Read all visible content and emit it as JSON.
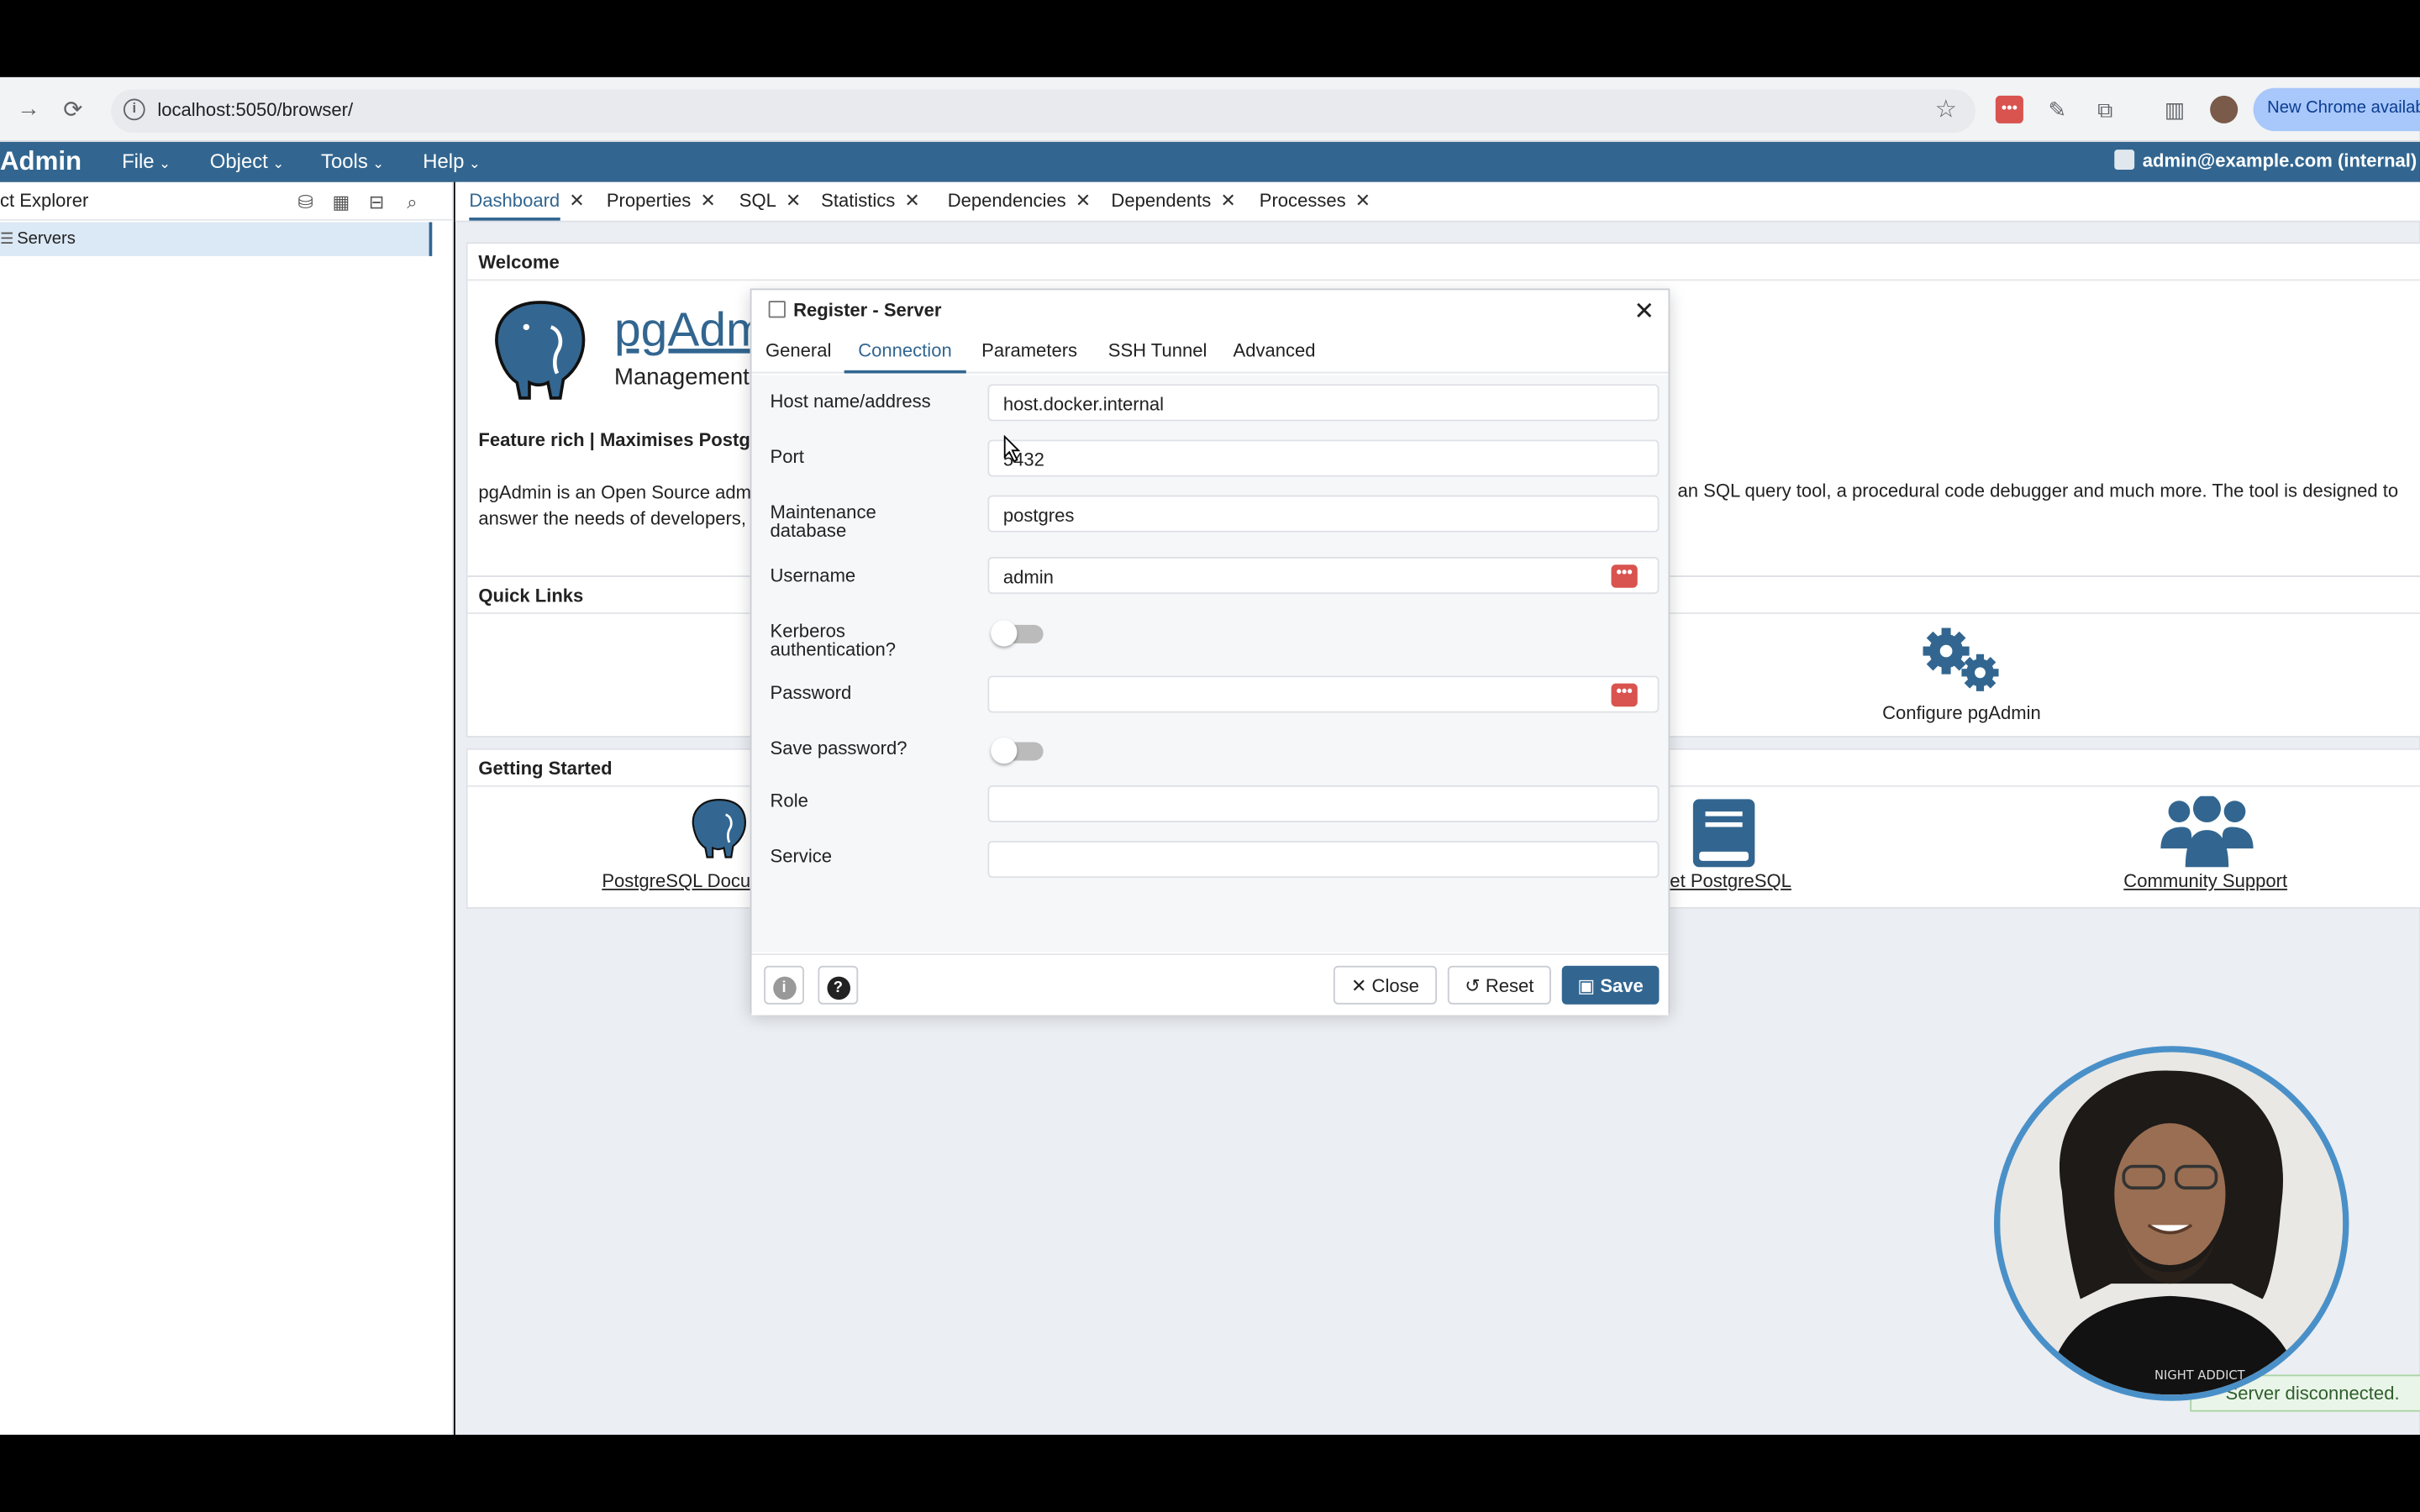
{
  "browser": {
    "url": "localhost:5050/browser/",
    "new_chrome_label": "New Chrome available"
  },
  "header": {
    "logo": "Admin",
    "menus": [
      "File",
      "Object",
      "Tools",
      "Help"
    ],
    "user": "admin@example.com (internal)"
  },
  "explorer": {
    "title": "ct Explorer",
    "items": [
      {
        "label": "Servers"
      }
    ]
  },
  "tabs": [
    {
      "label": "Dashboard"
    },
    {
      "label": "Properties"
    },
    {
      "label": "SQL"
    },
    {
      "label": "Statistics"
    },
    {
      "label": "Dependencies"
    },
    {
      "label": "Dependents"
    },
    {
      "label": "Processes"
    }
  ],
  "welcome": {
    "header": "Welcome",
    "product": "pgAdm",
    "subtitle": "Management",
    "feature": "Feature rich | Maximises Postgre",
    "desc_left": "pgAdmin is an Open Source adm answer the needs of developers,",
    "desc_right": "an SQL query tool, a procedural code debugger and much more. The tool is designed to"
  },
  "quick_links": {
    "header": "Quick Links",
    "configure": "Configure pgAdmin"
  },
  "getting_started": {
    "header": "Getting Started",
    "docs": "PostgreSQL Docu",
    "get": "et PostgreSQL",
    "community": "Community Support"
  },
  "dialog": {
    "title": "Register - Server",
    "tabs": [
      "General",
      "Connection",
      "Parameters",
      "SSH Tunnel",
      "Advanced"
    ],
    "active_tab": "Connection",
    "fields": {
      "host_label": "Host name/address",
      "host_value": "host.docker.internal",
      "port_label": "Port",
      "port_value": "5432",
      "maint_label": "Maintenance database",
      "maint_value": "postgres",
      "username_label": "Username",
      "username_value": "admin",
      "kerberos_label": "Kerberos authentication?",
      "password_label": "Password",
      "password_value": "",
      "savepw_label": "Save password?",
      "role_label": "Role",
      "role_value": "",
      "service_label": "Service",
      "service_value": ""
    },
    "buttons": {
      "close": "Close",
      "reset": "Reset",
      "save": "Save"
    }
  },
  "toast": "Server disconnected.",
  "webcam_shirt_text": "NIGHT ADDICT"
}
